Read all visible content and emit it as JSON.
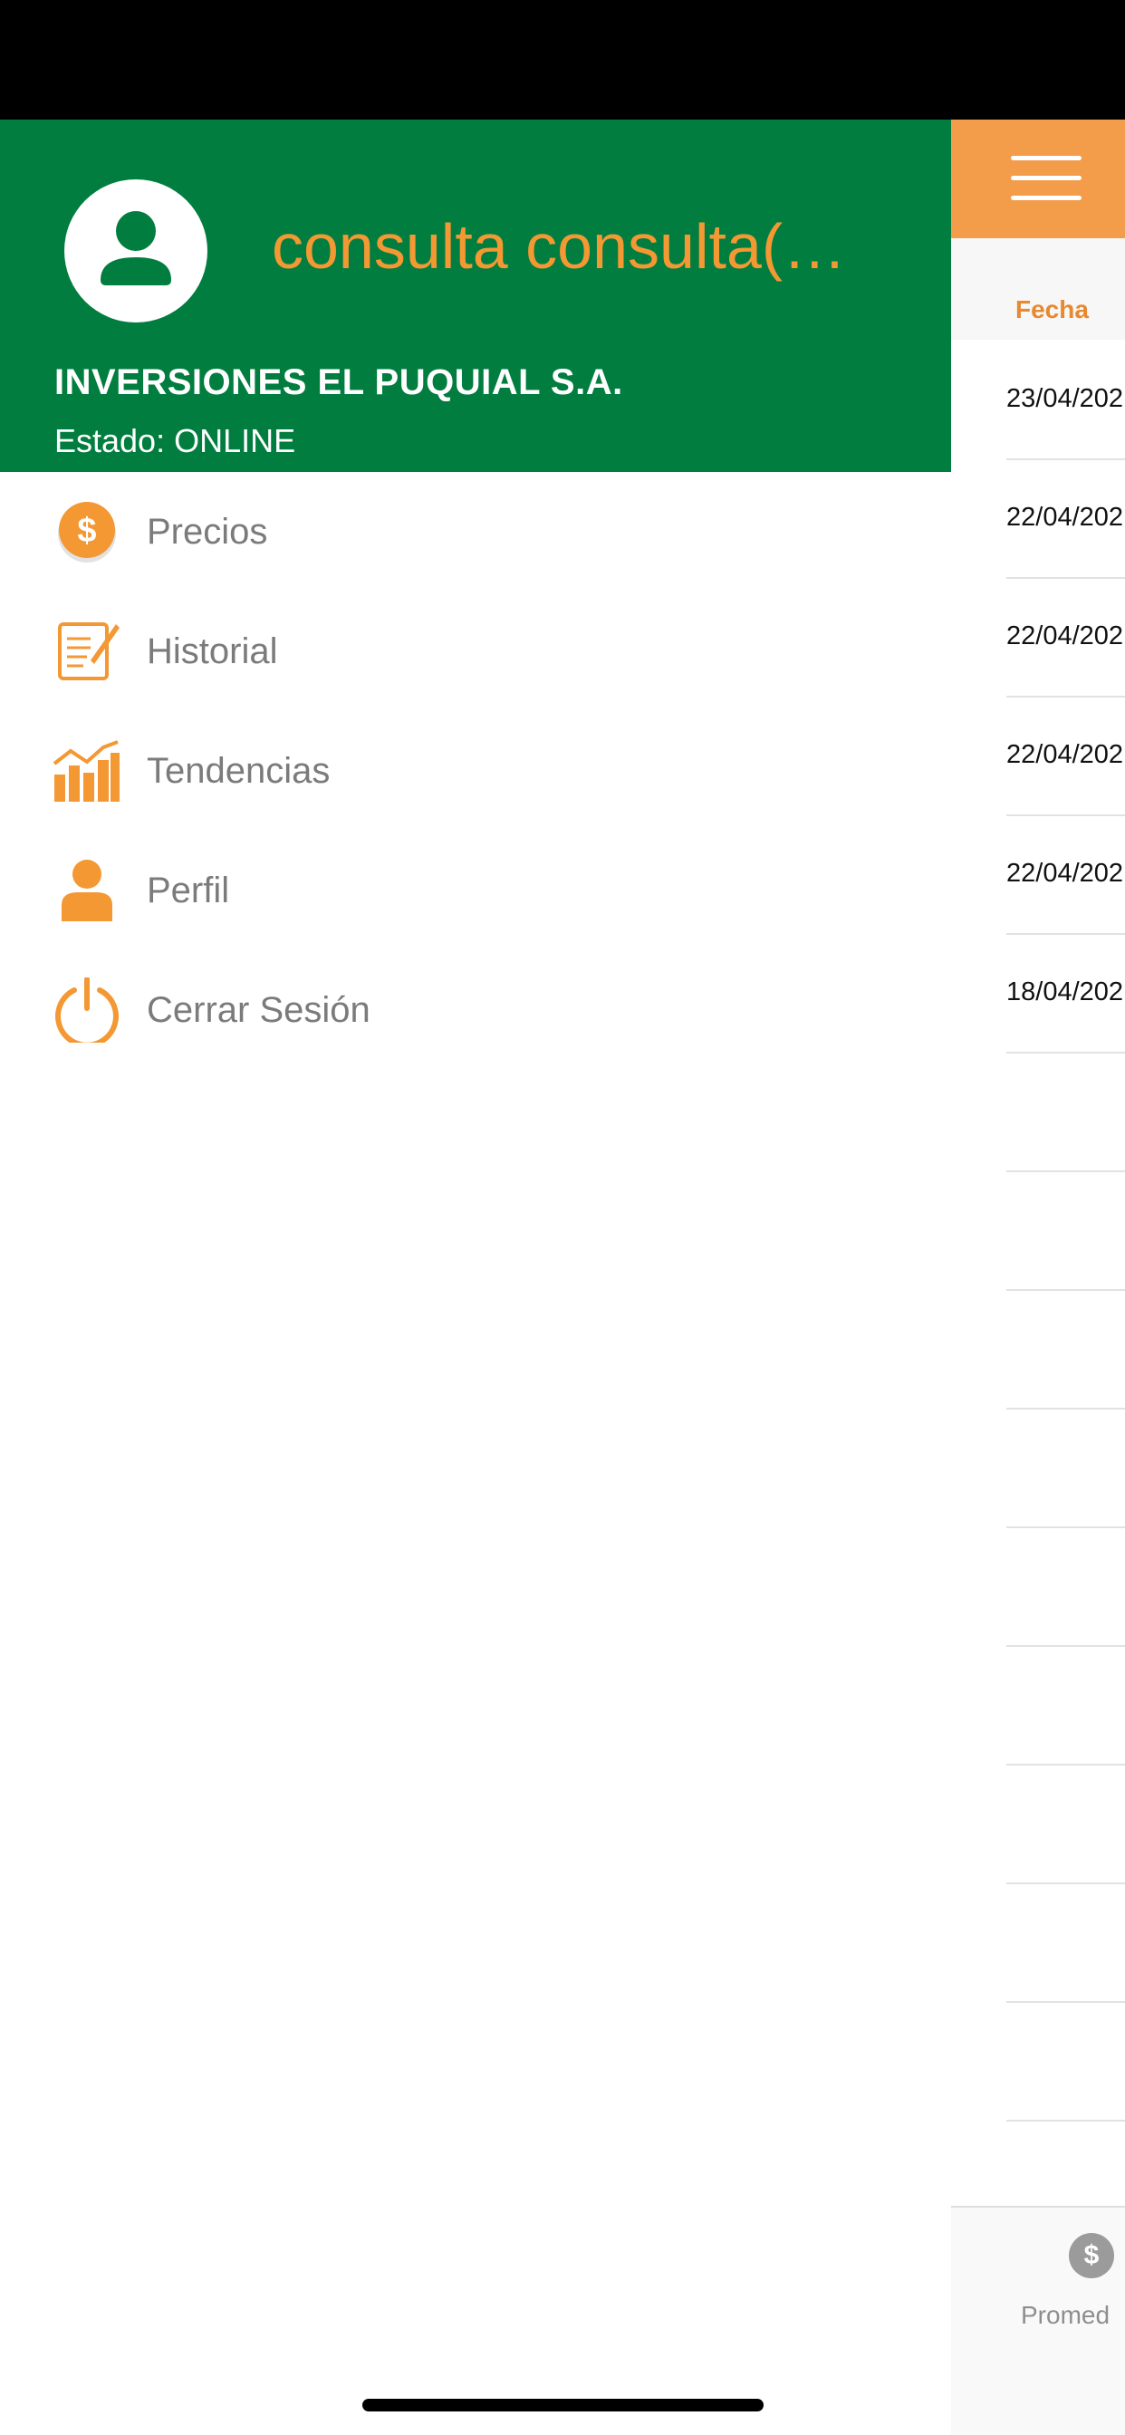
{
  "drawer": {
    "user_name": "consulta consulta(…",
    "company": "INVERSIONES EL PUQUIAL S.A.",
    "status": "Estado: ONLINE",
    "menu": [
      {
        "label": "Precios",
        "icon": "dollar-coin-icon"
      },
      {
        "label": "Historial",
        "icon": "document-quill-icon"
      },
      {
        "label": "Tendencias",
        "icon": "trending-chart-icon"
      },
      {
        "label": "Perfil",
        "icon": "person-icon"
      },
      {
        "label": "Cerrar Sesión",
        "icon": "power-icon"
      }
    ]
  },
  "background": {
    "column_header": "Fecha",
    "rows": [
      "23/04/202",
      "22/04/202",
      "22/04/202",
      "22/04/202",
      "22/04/202",
      "18/04/202"
    ],
    "tab_label": "Promed",
    "tab_icon_glyph": "$"
  },
  "colors": {
    "header_green": "#017e3f",
    "accent_orange": "#f39833",
    "hamburger_orange": "#f39c4a"
  }
}
